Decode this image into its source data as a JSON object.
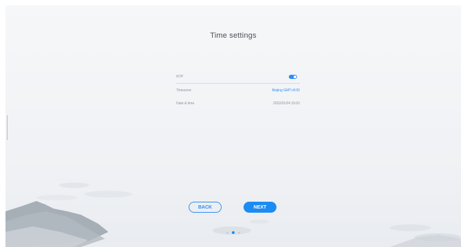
{
  "page": {
    "title": "Time settings"
  },
  "settings": {
    "ntp": {
      "label": "NTP",
      "enabled": true
    },
    "timezone": {
      "label": "Timezone",
      "value": "Beijing GMT+8:00"
    },
    "datetime": {
      "label": "Date & time",
      "value": "2022/01/24 15:02"
    }
  },
  "buttons": {
    "back": "BACK",
    "next": "NEXT"
  },
  "pagination": {
    "total": 3,
    "current": 2
  },
  "colors": {
    "accent": "#1c8cf2",
    "link": "#2f8cf0",
    "background": "#f2f4f6"
  },
  "icons": {
    "toggle": "toggle-switch-icon"
  }
}
